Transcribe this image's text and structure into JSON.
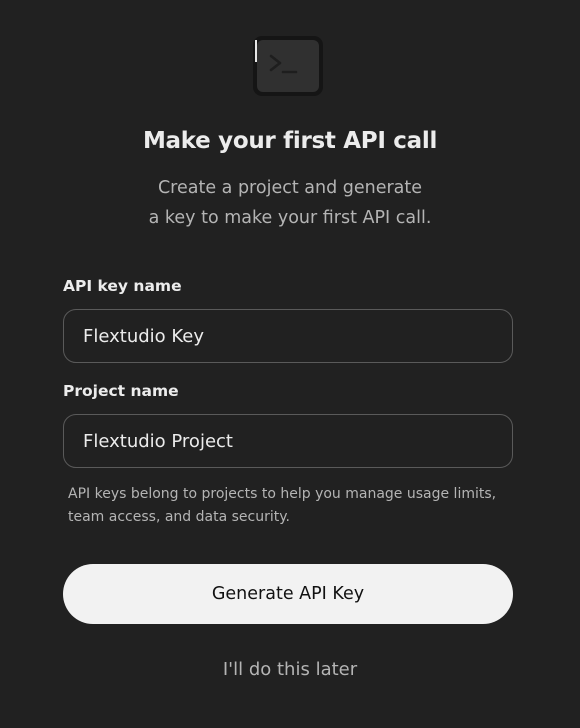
{
  "dialog": {
    "icon": "terminal-icon",
    "title": "Make your first API call",
    "subtitle_line1": "Create a project and generate",
    "subtitle_line2": "a key to make your first API call.",
    "api_key": {
      "label": "API key name",
      "value": "Flextudio Key"
    },
    "project": {
      "label": "Project name",
      "value": "Flextudio Project"
    },
    "helper_line1": "API keys belong to projects to help you manage usage limits,",
    "helper_line2": "team access, and data security.",
    "primary_button": "Generate API Key",
    "secondary_link": "I'll do this later"
  },
  "colors": {
    "background": "#212121",
    "text_primary": "#ececec",
    "text_secondary": "#b4b4b4",
    "button_bg": "#f2f2f2",
    "input_border": "#5a5a5a"
  }
}
